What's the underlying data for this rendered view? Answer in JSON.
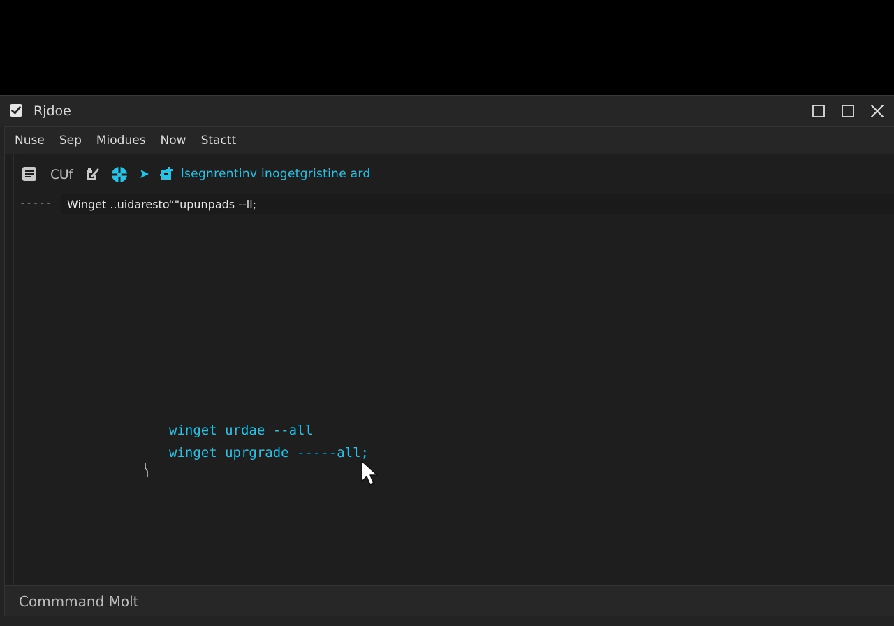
{
  "window": {
    "title": "Rjdoe"
  },
  "menu": {
    "items": [
      "Nuse",
      "Sep",
      "Miodues",
      "Now",
      "Stactt"
    ]
  },
  "toolbar": {
    "label": "CUf",
    "command_text": "lsegnrentinv inogetgristine ard",
    "icons": [
      "document-icon",
      "edit-icon",
      "target-icon",
      "play-icon",
      "add-icon"
    ]
  },
  "input": {
    "prompt": "-----",
    "value": "Winget ..uidaresto“\"upunpads --ll;"
  },
  "output": {
    "lines": [
      "winget urdae --all",
      "winget uprgrade -----all;"
    ]
  },
  "status": {
    "text": "Commmand Molt"
  },
  "colors": {
    "accent": "#27c2e6",
    "background": "#1e1e1e",
    "titlebar": "#262626"
  }
}
